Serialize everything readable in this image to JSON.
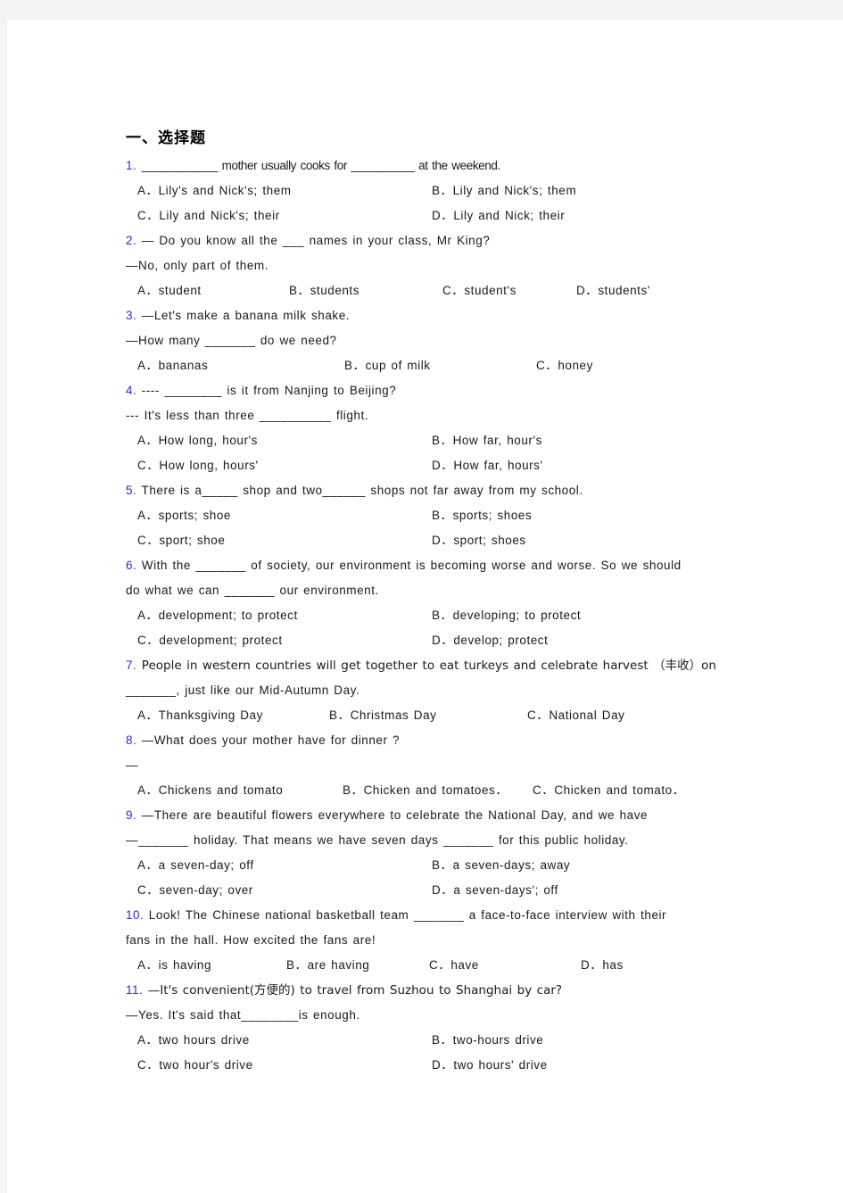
{
  "document": {
    "section_title": "一、选择题",
    "questions": [
      {
        "number": "1.",
        "stem_lines": [
          "____________  mother  usually  cooks  for  __________  at  the  weekend."
        ],
        "option_layout": "two-column",
        "options": [
          "A．Lily's and Nick's; them",
          "B．Lily and Nick's; them",
          "C．Lily and Nick's; their",
          "D．Lily and Nick; their"
        ]
      },
      {
        "number": "2.",
        "stem_lines": [
          "—  Do  you  know  all  the  ___    names  in  your  class,  Mr King?",
          "—No,  only  part  of  them."
        ],
        "option_layout": "four-column",
        "options": [
          "A．student",
          "B．students",
          "C．student's",
          "D．students'"
        ]
      },
      {
        "number": "3.",
        "stem_lines": [
          "—Let's  make  a  banana  milk  shake.",
          "—How  many  _______  do  we  need?"
        ],
        "option_layout": "three-column",
        "options": [
          "A．bananas",
          "B．cup of milk",
          "C．honey"
        ]
      },
      {
        "number": "4.",
        "stem_lines": [
          "----  ________  is  it  from  Nanjing  to  Beijing?",
          "---  It's  less  than  three  __________  flight."
        ],
        "option_layout": "two-column",
        "options": [
          "A．How long, hour's",
          "B．How far, hour's",
          "C．How long, hours'",
          "D．How far, hours'"
        ]
      },
      {
        "number": "5.",
        "stem_lines": [
          "There is a_____  shop and two______  shops not far away from my school."
        ],
        "option_layout": "two-column",
        "options": [
          "A．sports; shoe",
          "B．sports; shoes",
          "C．sport; shoe",
          "D．sport; shoes"
        ]
      },
      {
        "number": "6.",
        "stem_lines": [
          "With the  _______  of society, our environment is becoming worse and worse. So we should",
          "do what we can  _______  our environment."
        ],
        "option_layout": "two-column",
        "options": [
          "A．development; to protect",
          "B．developing; to protect",
          "C．development; protect",
          "D．develop; protect"
        ]
      },
      {
        "number": "7.",
        "stem_lines": [
          "People in western countries will get together to eat turkeys and celebrate harvest （丰收）on",
          "_______, just like our Mid-Autumn Day."
        ],
        "option_layout": "three-column",
        "options": [
          "A．Thanksgiving Day",
          "B．Christmas Day",
          "C．National Day"
        ]
      },
      {
        "number": "8.",
        "stem_lines": [
          "—What does your mother have for dinner ?",
          "—"
        ],
        "option_layout": "three-column",
        "options": [
          "A．Chickens and tomato",
          "B．Chicken and tomatoes．",
          "C．Chicken and tomato．"
        ]
      },
      {
        "number": "9.",
        "stem_lines": [
          "—There are beautiful flowers everywhere to celebrate the National Day, and we have",
          "—_______ holiday. That means we have seven days _______ for this public holiday."
        ],
        "option_layout": "two-column",
        "options": [
          "A．a seven-day; off",
          "B．a seven-days; away",
          "C．seven-day; over",
          "D．a seven-days'; off"
        ]
      },
      {
        "number": "10.",
        "stem_lines": [
          "Look! The Chinese national basketball team _______ a face-to-face interview with their",
          "fans in the hall. How excited the fans are!"
        ],
        "option_layout": "four-column",
        "options": [
          "A．is having",
          "B．are having",
          "C．have",
          "D．has"
        ]
      },
      {
        "number": "11.",
        "stem_lines": [
          "—It's convenient(方便的) to travel from Suzhou to Shanghai by car?",
          "—Yes. It's said that________is enough."
        ],
        "option_layout": "two-column",
        "options": [
          "A．two hours drive",
          "B．two-hours drive",
          "C．two hour's drive",
          "D．two hours' drive"
        ]
      }
    ]
  },
  "colors": {
    "question_number": "#2b2bcc",
    "body_text": "#1a1a1a",
    "page_background": "#ffffff",
    "chrome_gray": "#f4f4f4"
  }
}
